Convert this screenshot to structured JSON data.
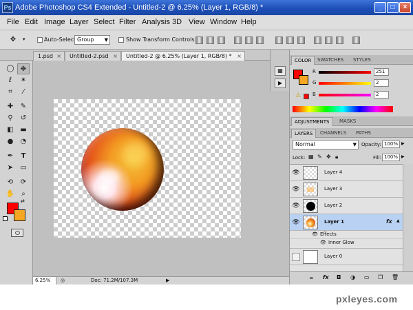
{
  "window": {
    "app_icon": "Ps",
    "title": "Adobe Photoshop CS4 Extended - Untitled-2 @ 6.25% (Layer 1, RGB/8) *",
    "buttons": [
      "minimize-icon",
      "maximize-icon",
      "close-icon"
    ]
  },
  "menu": [
    "File",
    "Edit",
    "Image",
    "Layer",
    "Select",
    "Filter",
    "Analysis",
    "3D",
    "View",
    "Window",
    "Help"
  ],
  "options_bar": {
    "auto_select_label": "Auto-Select:",
    "auto_select_value": "Group",
    "show_transform_label": "Show Transform Controls"
  },
  "doc_tabs": [
    {
      "label": "1.psd",
      "close": "×"
    },
    {
      "label": "Untitled-2.psd",
      "close": "×"
    },
    {
      "label": "Untitled-2 @ 6.25% (Layer 1, RGB/8) *",
      "close": "×"
    }
  ],
  "colors": {
    "foreground": "#ff0000",
    "background": "#f5a623",
    "planet_core": "#f39a22",
    "layer_selected": "#b9d2f4"
  },
  "status": {
    "zoom": "6.25%",
    "doc": "Doc: 71.2M/107.3M"
  },
  "color_panel": {
    "tabs": [
      "COLOR",
      "SWATCHES",
      "STYLES"
    ],
    "channels": [
      {
        "label": "R",
        "value": "251"
      },
      {
        "label": "G",
        "value": "2"
      },
      {
        "label": "B",
        "value": "2"
      }
    ]
  },
  "adjust_tabs": [
    "ADJUSTMENTS",
    "MASKS"
  ],
  "layers_panel": {
    "tabs": [
      "LAYERS",
      "CHANNELS",
      "PATHS"
    ],
    "blend_mode": "Normal",
    "opacity_label": "Opacity:",
    "opacity": "100%",
    "lock_label": "Lock:",
    "fill_label": "Fill:",
    "fill": "100%",
    "layers": [
      {
        "name": "Layer 4",
        "fx": ""
      },
      {
        "name": "Layer 3",
        "fx": ""
      },
      {
        "name": "Layer 2",
        "fx": ""
      },
      {
        "name": "Layer 1",
        "fx": "fx"
      },
      {
        "name": "Layer 0",
        "fx": ""
      }
    ],
    "effects_label": "Effects",
    "inner_glow_label": "Inner Glow"
  },
  "watermark": "pxleyes.com"
}
